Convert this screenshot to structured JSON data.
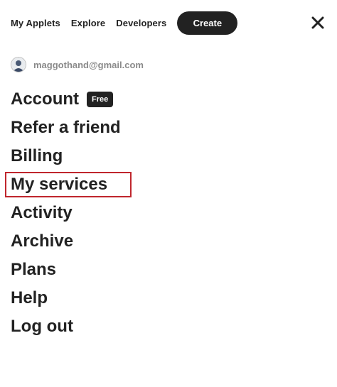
{
  "nav": {
    "links": [
      "My Applets",
      "Explore",
      "Developers"
    ],
    "create_label": "Create",
    "close_icon": "close-icon"
  },
  "user": {
    "email": "maggothand@gmail.com",
    "avatar_icon": "avatar"
  },
  "menu": {
    "account_label": "Account",
    "account_badge": "Free",
    "items": [
      "Refer a friend",
      "Billing",
      "My services",
      "Activity",
      "Archive",
      "Plans",
      "Help",
      "Log out"
    ],
    "highlighted_item": "My services",
    "highlight_color": "#c0262d"
  }
}
